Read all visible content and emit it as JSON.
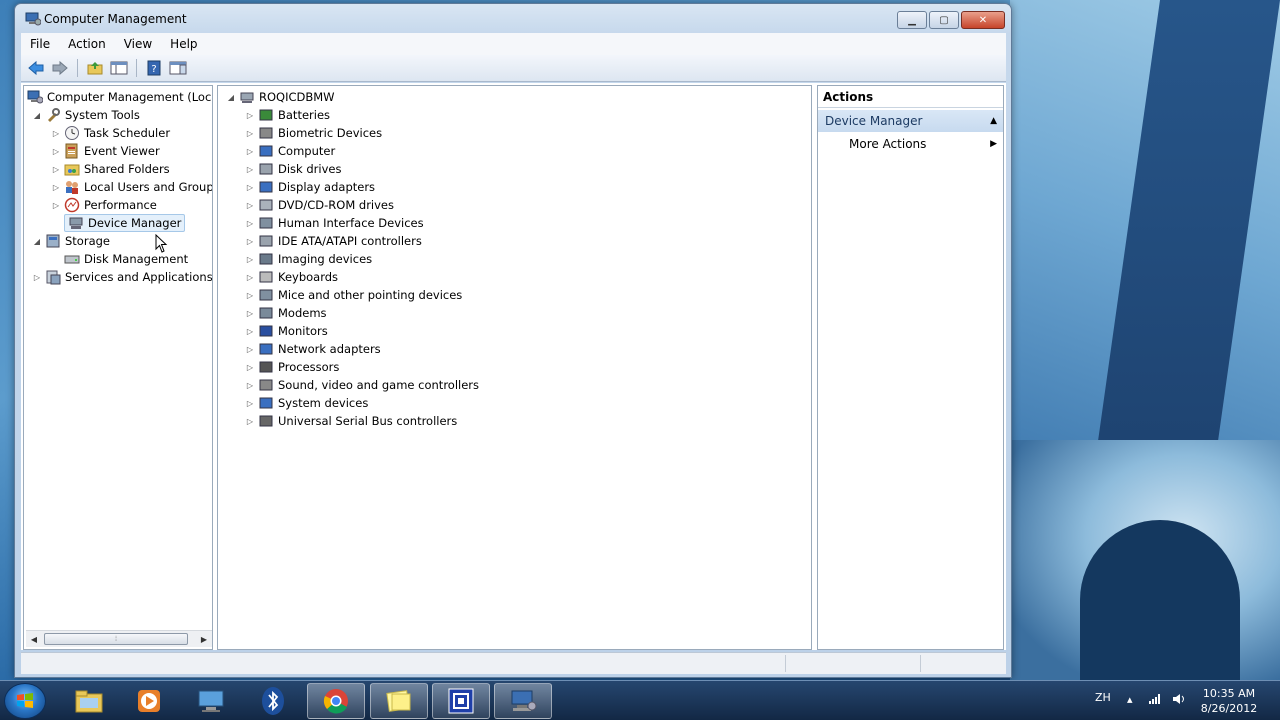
{
  "window": {
    "title": "Computer Management"
  },
  "menu": [
    "File",
    "Action",
    "View",
    "Help"
  ],
  "left_tree": [
    {
      "label": "Computer Management (Local",
      "indent": 0,
      "toggle": "",
      "icon": "computer-management-icon"
    },
    {
      "label": "System Tools",
      "indent": 1,
      "toggle": "open",
      "icon": "system-tools-icon"
    },
    {
      "label": "Task Scheduler",
      "indent": 2,
      "toggle": "closed",
      "icon": "task-scheduler-icon"
    },
    {
      "label": "Event Viewer",
      "indent": 2,
      "toggle": "closed",
      "icon": "event-viewer-icon"
    },
    {
      "label": "Shared Folders",
      "indent": 2,
      "toggle": "closed",
      "icon": "shared-folders-icon"
    },
    {
      "label": "Local Users and Groups",
      "indent": 2,
      "toggle": "closed",
      "icon": "local-users-icon"
    },
    {
      "label": "Performance",
      "indent": 2,
      "toggle": "closed",
      "icon": "performance-icon"
    },
    {
      "label": "Device Manager",
      "indent": 2,
      "toggle": "",
      "icon": "device-manager-icon",
      "selected": true
    },
    {
      "label": "Storage",
      "indent": 1,
      "toggle": "open",
      "icon": "storage-icon"
    },
    {
      "label": "Disk Management",
      "indent": 2,
      "toggle": "",
      "icon": "disk-management-icon"
    },
    {
      "label": "Services and Applications",
      "indent": 1,
      "toggle": "closed",
      "icon": "services-icon"
    }
  ],
  "device_tree": {
    "root": "ROQICDBMW",
    "categories": [
      "Batteries",
      "Biometric Devices",
      "Computer",
      "Disk drives",
      "Display adapters",
      "DVD/CD-ROM drives",
      "Human Interface Devices",
      "IDE ATA/ATAPI controllers",
      "Imaging devices",
      "Keyboards",
      "Mice and other pointing devices",
      "Modems",
      "Monitors",
      "Network adapters",
      "Processors",
      "Sound, video and game controllers",
      "System devices",
      "Universal Serial Bus controllers"
    ]
  },
  "actions": {
    "header": "Actions",
    "section": "Device Manager",
    "items": [
      "More Actions"
    ]
  },
  "taskbar": {
    "apps": [
      "explorer-icon",
      "media-player-icon",
      "remote-desktop-icon",
      "bluetooth-icon",
      "chrome-icon",
      "sticky-notes-icon",
      "app-icon",
      "computer-management-icon"
    ],
    "lang": "ZH",
    "time": "10:35 AM",
    "date": "8/26/2012"
  },
  "colors": {
    "accent": "#3a78c4",
    "selection": "#e4f0fb"
  }
}
